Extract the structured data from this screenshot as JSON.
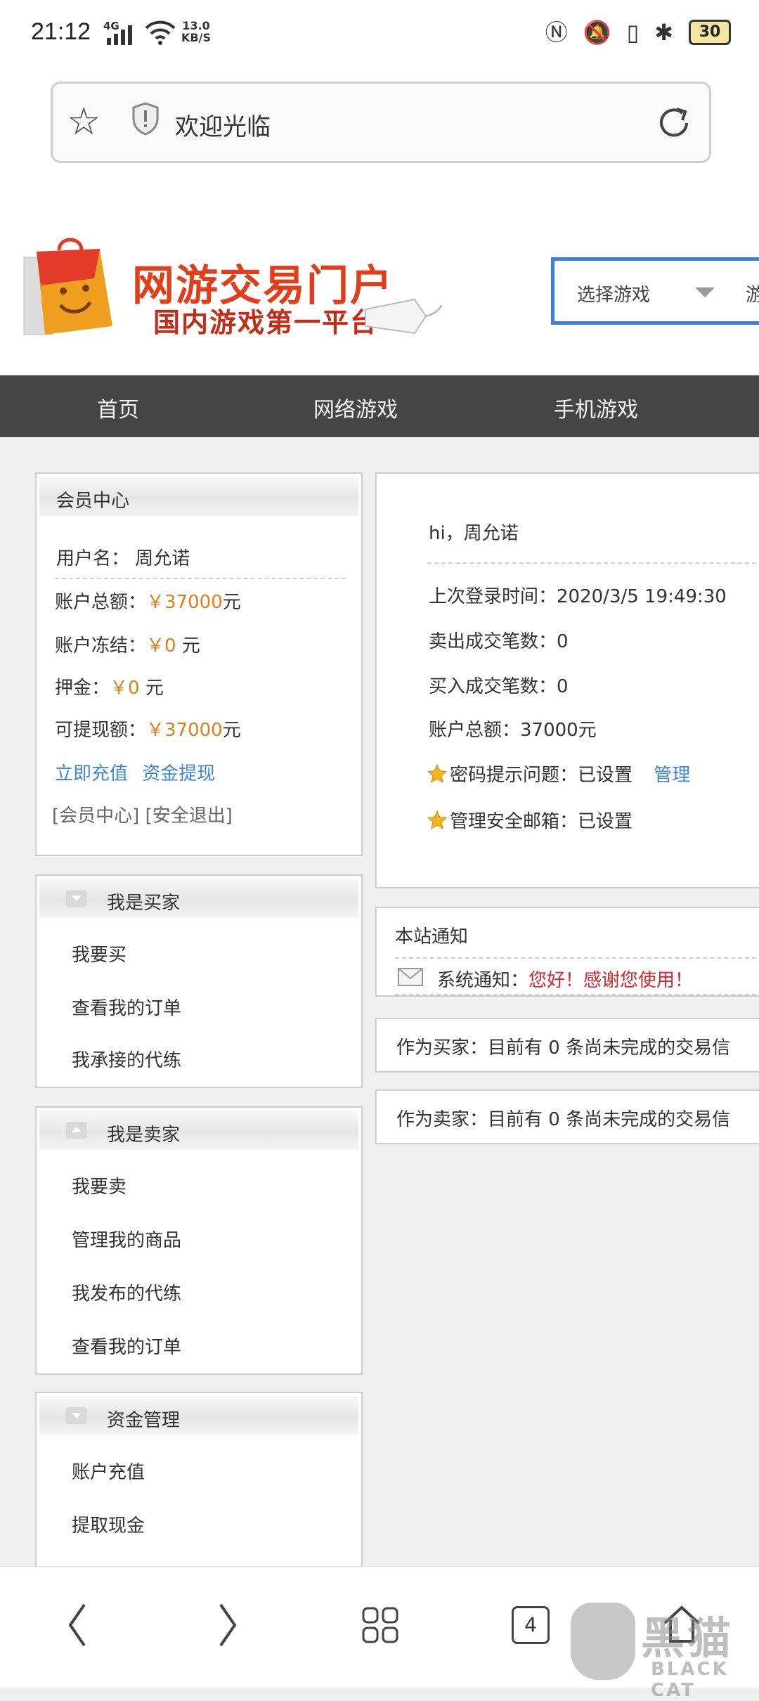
{
  "status_bar": {
    "time": "21:12",
    "network": "4G",
    "speed_value": "13.0",
    "speed_unit": "KB/S",
    "battery": "30"
  },
  "browser": {
    "page_title": "欢迎光临"
  },
  "header": {
    "logo_line1": "网游交易门户",
    "logo_line2": "国内游戏第一平台",
    "game_select_label": "选择游戏",
    "game_select_extra": "游"
  },
  "nav": {
    "items": [
      "首页",
      "网络游戏",
      "手机游戏"
    ]
  },
  "member_center": {
    "title": "会员中心",
    "username_label": "用户名：",
    "username": "周允诺",
    "total_label": "账户总额：",
    "total_value": "￥37000",
    "frozen_label": "账户冻结：",
    "frozen_value": "￥0",
    "deposit_label": "押金：",
    "deposit_value": "￥0",
    "withdrawable_label": "可提现额：",
    "withdrawable_value": "￥37000",
    "unit": "元",
    "recharge_link": "立即充值",
    "withdraw_link": "资金提现",
    "member_link": "[会员中心]",
    "logout_link": "[安全退出]"
  },
  "buyer_menu": {
    "title": "我是买家",
    "items": [
      "我要买",
      "查看我的订单",
      "我承接的代练"
    ]
  },
  "seller_menu": {
    "title": "我是卖家",
    "items": [
      "我要卖",
      "管理我的商品",
      "我发布的代练",
      "查看我的订单"
    ]
  },
  "funds_menu": {
    "title": "资金管理",
    "items": [
      "账户充值",
      "提取现金"
    ]
  },
  "welcome": {
    "greeting": "hi，周允诺",
    "last_login_label": "上次登录时间：",
    "last_login_value": "2020/3/5 19:49:30",
    "sold_label": "卖出成交笔数：",
    "sold_value": "0",
    "bought_label": "买入成交笔数：",
    "bought_value": "0",
    "total_label": "账户总额：",
    "total_value": "37000元",
    "pwd_hint_label": "密码提示问题：",
    "pwd_hint_value": "已设置",
    "manage_link": "管理",
    "email_label": "管理安全邮箱：",
    "email_value": "已设置"
  },
  "notice": {
    "title": "本站通知",
    "system_label": "系统通知：",
    "system_message": "您好！感谢您使用！"
  },
  "buyer_status": "作为买家：目前有 0 条尚未完成的交易信",
  "seller_status": "作为卖家：目前有 0 条尚未完成的交易信",
  "bottom_bar": {
    "tab_count": "4"
  },
  "watermark": {
    "text": "黑猫",
    "sub": "BLACK CAT"
  }
}
